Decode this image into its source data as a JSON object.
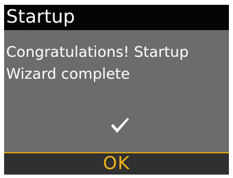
{
  "header": {
    "title": "Startup"
  },
  "message": {
    "line1": "Congratulations! Startup",
    "line2": "Wizard complete"
  },
  "status_icon": "checkmark-icon",
  "softkey": {
    "label": "OK"
  },
  "colors": {
    "screen_background": "#6b6c6e",
    "title_background": "#050505",
    "text": "#ffffff",
    "accent": "#f1b51b",
    "softkey_background": "#303030"
  }
}
